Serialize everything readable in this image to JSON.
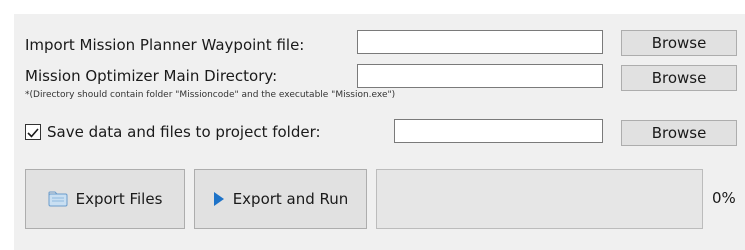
{
  "rows": [
    {
      "label": "Import Mission Planner Waypoint file:",
      "value": "",
      "button": "Browse"
    },
    {
      "label": "Mission Optimizer Main Directory:",
      "value": "",
      "button": "Browse"
    },
    {
      "label": "Save data and files to project folder:",
      "value": "",
      "button": "Browse",
      "checked": true
    }
  ],
  "directory_note": "*(Directory should contain folder \"Missioncode\" and the executable \"Mission.exe\")",
  "actions": {
    "export_files": "Export Files",
    "export_and_run": "Export and Run"
  },
  "progress": {
    "value": 0,
    "label": "0%"
  },
  "colors": {
    "panel": "#f0f0f0",
    "button": "#e1e1e1",
    "play_icon": "#1e73c8",
    "progress_fill": "#06b025"
  }
}
